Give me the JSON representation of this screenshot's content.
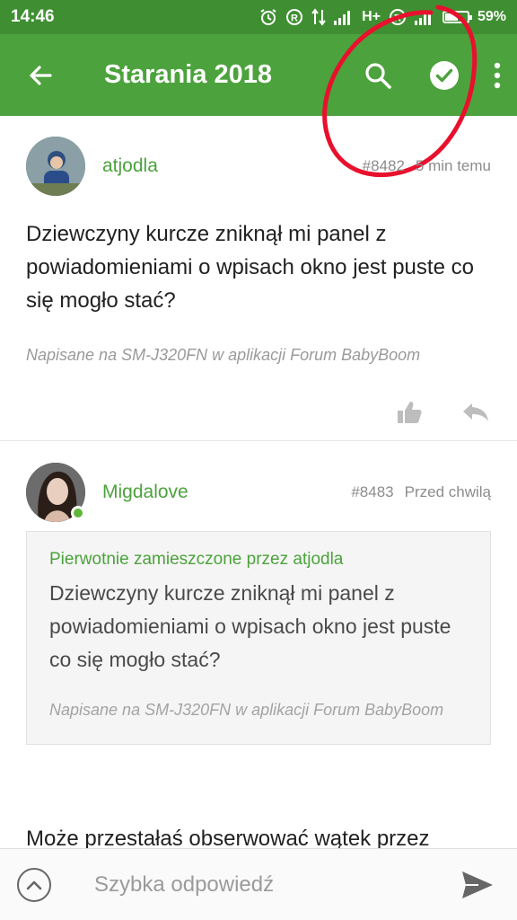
{
  "status_bar": {
    "time": "14:46",
    "network": "H+",
    "battery_level": 0.59,
    "battery_text": "59%",
    "icons": [
      "alarm-icon",
      "registered-icon",
      "data-arrows-icon",
      "signal-icon",
      "signal-icon",
      "battery-icon"
    ]
  },
  "app_bar": {
    "title": "Starania 2018",
    "back_icon": "arrow-left-icon",
    "search_icon": "search-icon",
    "check_icon": "check-circle-icon",
    "more_icon": "more-vert-icon",
    "color": "#4ca23c"
  },
  "posts": [
    {
      "author": "atjodla",
      "number": "#8482",
      "time": "5 min temu",
      "body": "Dziewczyny kurcze zniknął mi panel z powiadomieniami o wpisach okno jest puste co się mogło stać?",
      "signature": "Napisane na SM-J320FN w aplikacji Forum BabyBoom"
    },
    {
      "author": "Migdalove",
      "number": "#8483",
      "time": "Przed chwilą",
      "online": true,
      "quote": {
        "header": "Pierwotnie zamieszczone przez atjodla",
        "text": "Dziewczyny kurcze zniknął mi panel z powiadomieniami o wpisach okno jest puste co się mogło stać?",
        "signature": "Napisane na SM-J320FN w aplikacji Forum BabyBoom"
      },
      "body_peek": "Może przestałaś obserwować wątek przez"
    }
  ],
  "bottom_bar": {
    "placeholder": "Szybka odpowiedź"
  },
  "colors": {
    "status_bar": "#3f8f32",
    "accent": "#4ca23c",
    "annotation": "#e8102d"
  }
}
